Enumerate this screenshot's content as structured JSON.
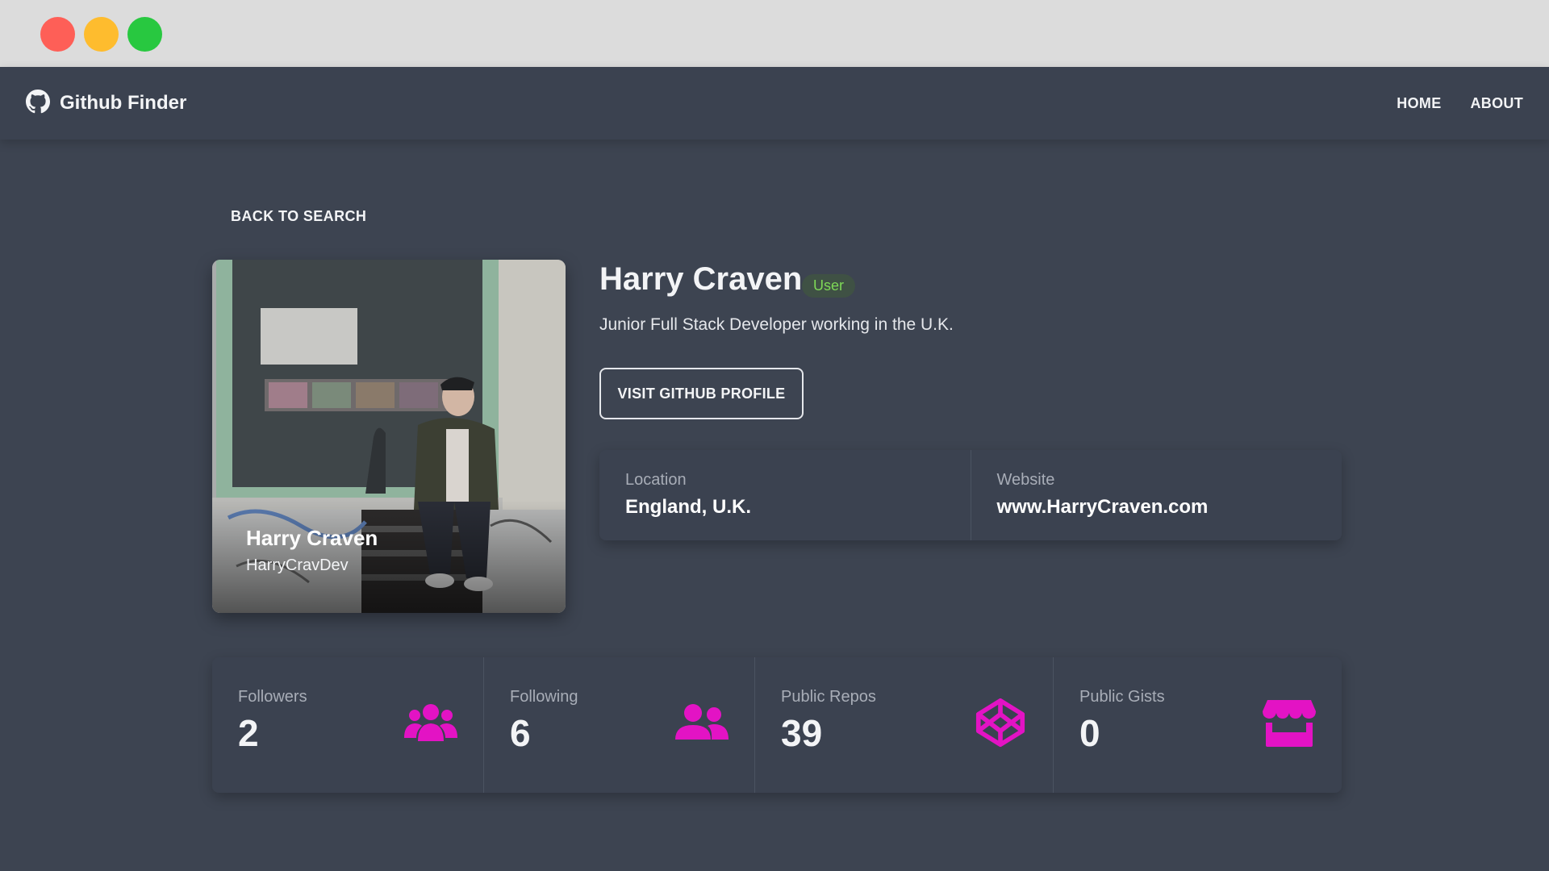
{
  "window": {
    "controls": [
      "close",
      "minimize",
      "maximize"
    ]
  },
  "navbar": {
    "brand": "Github Finder",
    "brand_icon": "github-icon",
    "links": [
      {
        "label": "HOME"
      },
      {
        "label": "ABOUT"
      }
    ]
  },
  "back_link": "BACK TO SEARCH",
  "profile": {
    "name": "Harry Craven",
    "login": "HarryCravDev",
    "type_badge": "User",
    "bio": "Junior Full Stack Developer working in the U.K.",
    "visit_button": "VISIT GITHUB PROFILE",
    "location_label": "Location",
    "location": "England, U.K.",
    "website_label": "Website",
    "website": "www.HarryCraven.com"
  },
  "stats": [
    {
      "label": "Followers",
      "value": "2",
      "icon": "users-icon"
    },
    {
      "label": "Following",
      "value": "6",
      "icon": "user-friends-icon"
    },
    {
      "label": "Public Repos",
      "value": "39",
      "icon": "codepen-icon"
    },
    {
      "label": "Public Gists",
      "value": "0",
      "icon": "store-icon"
    }
  ],
  "colors": {
    "background": "#3d4451",
    "accent_icon": "#e313c4",
    "badge_text": "#7ed957"
  }
}
